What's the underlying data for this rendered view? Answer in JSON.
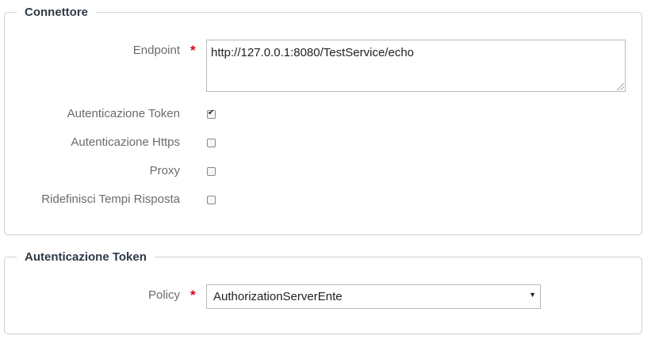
{
  "connettore": {
    "legend": "Connettore",
    "endpoint_label": "Endpoint",
    "endpoint_value": "http://127.0.0.1:8080/TestService/echo",
    "required_mark": "*",
    "options": [
      {
        "label": "Autenticazione Token",
        "checked": true
      },
      {
        "label": "Autenticazione Https",
        "checked": false
      },
      {
        "label": "Proxy",
        "checked": false
      },
      {
        "label": "Ridefinisci Tempi Risposta",
        "checked": false
      }
    ]
  },
  "token": {
    "legend": "Autenticazione Token",
    "policy_label": "Policy",
    "required_mark": "*",
    "policy_value": "AuthorizationServerEnte"
  }
}
